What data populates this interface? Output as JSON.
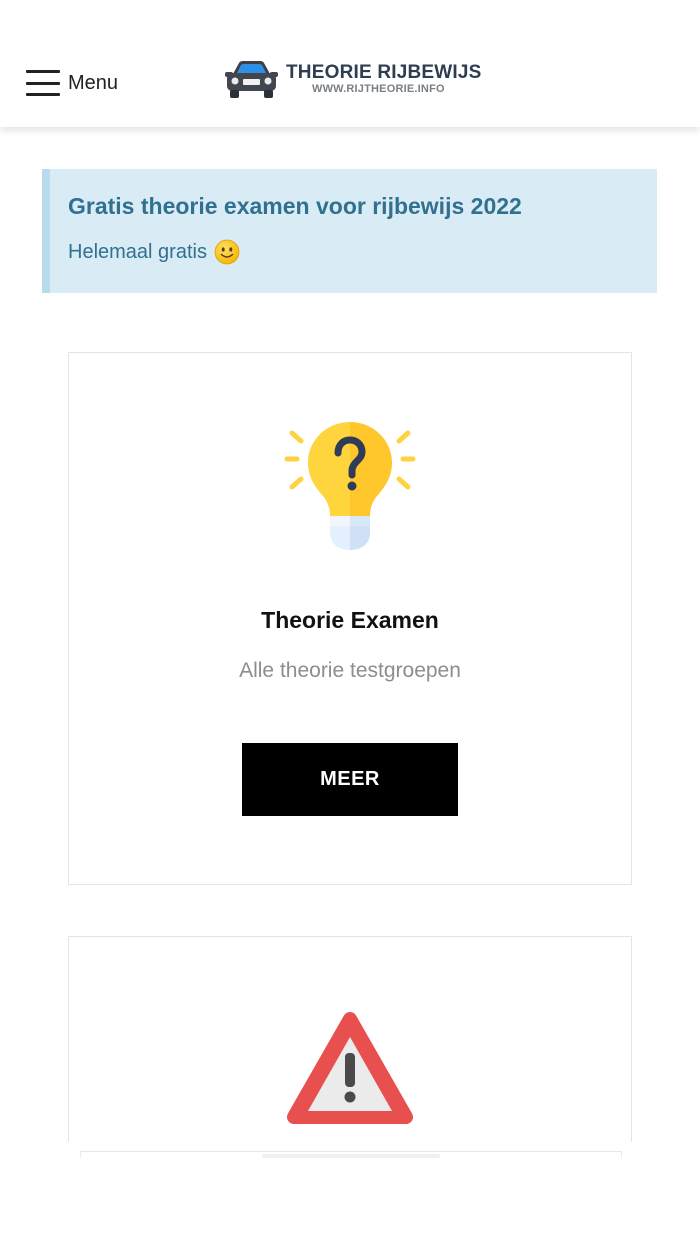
{
  "header": {
    "menu_label": "Menu",
    "logo_title": "THEORIE RIJBEWIJS",
    "logo_subtitle": "WWW.RIJTHEORIE.INFO"
  },
  "notice": {
    "title": "Gratis theorie examen voor rijbewijs 2022",
    "text": "Helemaal gratis",
    "emoji_icon": "smiley-icon"
  },
  "cards": [
    {
      "icon": "lightbulb-question-icon",
      "title": "Theorie Examen",
      "subtitle": "Alle theorie testgroepen",
      "button_label": "MEER"
    },
    {
      "icon": "warning-triangle-icon"
    }
  ],
  "colors": {
    "notice_bg": "#d9ecf5",
    "notice_text": "#31708f",
    "button_bg": "#000000",
    "warning_red": "#e8504f",
    "bulb_yellow": "#ffd23f"
  }
}
